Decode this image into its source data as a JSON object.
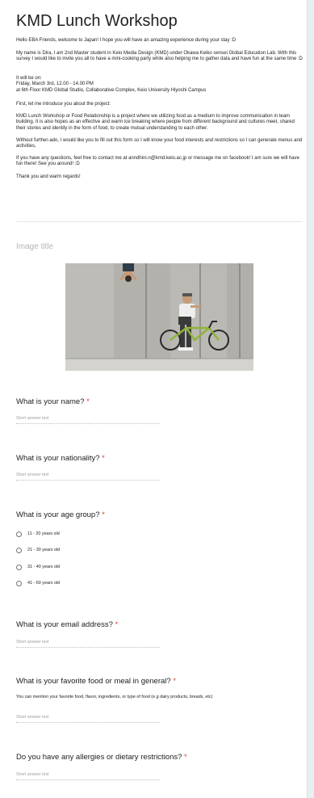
{
  "form": {
    "title": "KMD Lunch Workshop",
    "description": [
      "Hello EBA Friends, welcome to Japan! I hope you will have an amazing experience during your stay :D",
      "My name is Dira, I am 2nd Master student in Keio Media Design (KMD) under Okawa Keiko sensei Global Education Lab. With this survey I would like to invite you all to have a mini-cooking party while also helping me to gather data and have fun at the same time :D",
      "It will be on:\nFriday, March 3rd, 12.00 - 14.00 PM\nat 6th Floor KMD Global Studio, Collaborative Complex, Keio University Hiyoshi Campus",
      "First, let me introduce you about the project:",
      "KMD Lunch Workshop or Food Relationship is a project where we utilizing food as a medium to improve communication in team building. It is also hopes as an effective and warm ice breaking where people from different background and cultures meet, shared their stories and identity in the form of food, to create mutual understanding to each other.",
      "Without further-ado, I would like you to fill out this form so I will know your food interests and restrictions so I can generate menus and activities,",
      "If you have any questions, feel free to contact me at anndhini.n@kmd.keio.ac.jp or message me on facebook! I am sure we will have fun there! See you around! :D",
      "Thank you and warm regards!"
    ],
    "image_title": "Image title"
  },
  "questions": {
    "name": {
      "title": "What is your name?",
      "required_mark": "*",
      "placeholder": "Short answer text"
    },
    "nationality": {
      "title": "What is your nationality?",
      "required_mark": "*",
      "placeholder": "Short answer text"
    },
    "age": {
      "title": "What is your age group?",
      "required_mark": "*",
      "options": [
        "11 - 20 years old",
        "21 - 30 years old",
        "31 - 40 years old",
        "41 - 60 years old"
      ]
    },
    "email": {
      "title": "What is your email address?",
      "required_mark": "*",
      "placeholder": "Short answer text"
    },
    "food": {
      "title": "What is your favorite food or meal in general?",
      "required_mark": "*",
      "help": "You can mention your favorite food, flavor, ingredients, or type of food (e.g dairy products, breads, etc)",
      "placeholder": "Short answer text"
    },
    "allergy": {
      "title": "Do you have any allergies or dietary restrictions?",
      "required_mark": "*",
      "placeholder": "Short answer text"
    }
  },
  "colors": {
    "required": "#db4437",
    "title_text": "#202124",
    "placeholder": "#9e9e9e"
  }
}
